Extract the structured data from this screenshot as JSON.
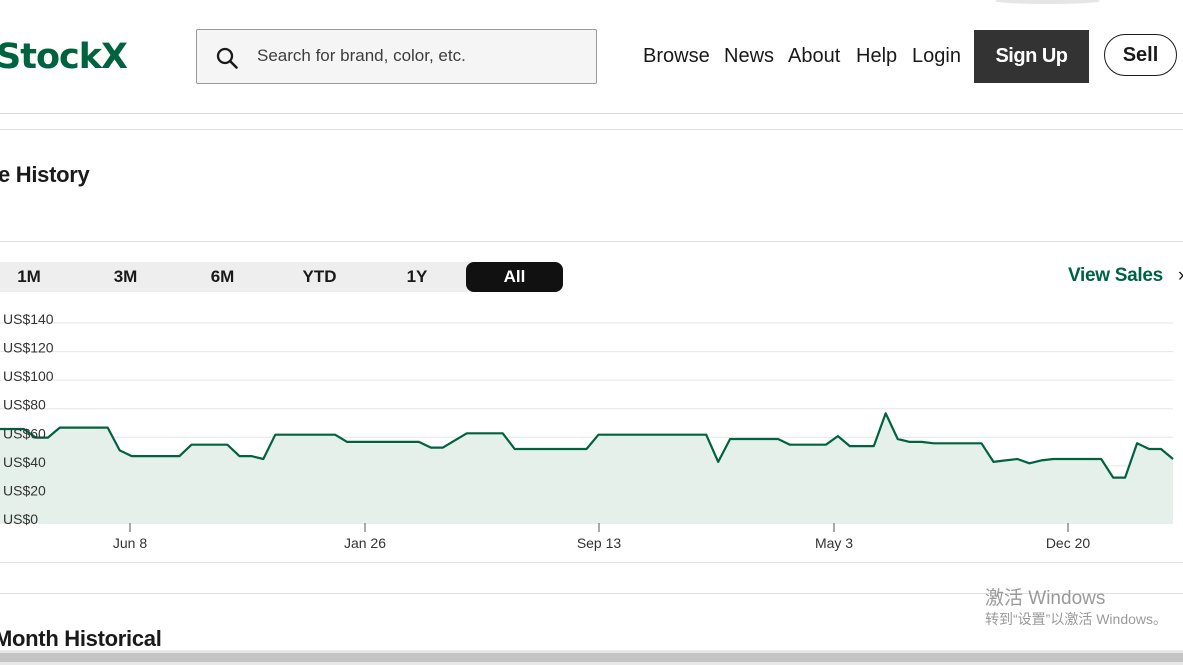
{
  "header": {
    "logo": "StockX",
    "search": {
      "placeholder": "Search for brand, color, etc.",
      "value": ""
    },
    "nav": [
      "Browse",
      "News",
      "About",
      "Help",
      "Login"
    ],
    "signup_label": "Sign Up",
    "sell_label": "Sell"
  },
  "sections": {
    "price_history_title": "e History",
    "month_historical_title": "Month Historical"
  },
  "range": {
    "options": [
      "1M",
      "3M",
      "6M",
      "YTD",
      "1Y",
      "All"
    ],
    "selected": "All"
  },
  "view_sales": {
    "label": "View Sales",
    "chevron": "›"
  },
  "chart_data": {
    "type": "area",
    "ylabels": [
      "US$140",
      "US$120",
      "US$100",
      "US$80",
      "US$60",
      "US$40",
      "US$20",
      "US$0"
    ],
    "ylim": [
      0,
      140
    ],
    "xticks": [
      "Jun 8",
      "Jan 26",
      "Sep 13",
      "May 3",
      "Dec 20"
    ],
    "grid": true,
    "line_color": "#006340",
    "fill_color": "#e5f0eb",
    "series": [
      {
        "values": [
          63,
          63,
          63,
          57,
          57,
          64,
          64,
          64,
          64,
          64,
          48,
          44,
          44,
          44,
          44,
          44,
          52,
          52,
          52,
          52,
          44,
          44,
          42,
          59,
          59,
          59,
          59,
          59,
          59,
          54,
          54,
          54,
          54,
          54,
          54,
          54,
          50,
          50,
          55,
          60,
          60,
          60,
          60,
          49,
          49,
          49,
          49,
          49,
          49,
          49,
          59,
          59,
          59,
          59,
          59,
          59,
          59,
          59,
          59,
          59,
          40,
          56,
          56,
          56,
          56,
          56,
          52,
          52,
          52,
          52,
          58,
          51,
          51,
          51,
          74,
          56,
          54,
          54,
          53,
          53,
          53,
          53,
          53,
          40,
          41,
          42,
          39,
          41,
          42,
          42,
          42,
          42,
          42,
          29,
          29,
          53,
          49,
          49,
          42
        ]
      }
    ]
  },
  "watermark": {
    "title": "激活 Windows",
    "subtitle": "转到“设置”以激活 Windows。"
  }
}
